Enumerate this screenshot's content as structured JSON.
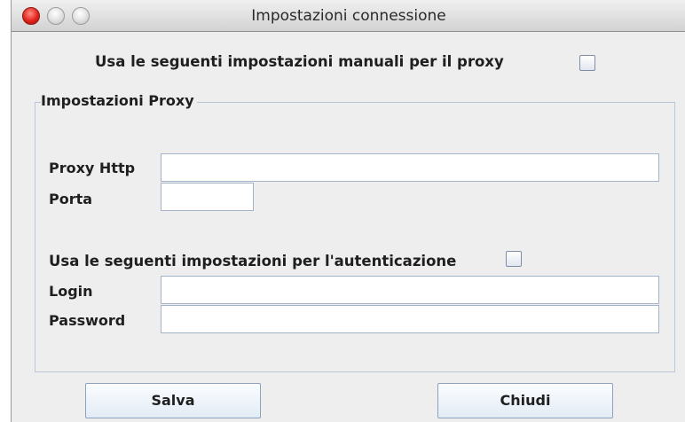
{
  "window": {
    "title": "Impostazioni connessione"
  },
  "proxy_toggle": {
    "label": "Usa le seguenti impostazioni manuali per il proxy",
    "checked": false
  },
  "proxy_group": {
    "title": "Impostazioni Proxy",
    "http_label": "Proxy Http",
    "http_value": "",
    "port_label": "Porta",
    "port_value": ""
  },
  "auth_toggle": {
    "label": "Usa le seguenti impostazioni per l'autenticazione",
    "checked": false
  },
  "auth": {
    "login_label": "Login",
    "login_value": "",
    "password_label": "Password",
    "password_value": ""
  },
  "buttons": {
    "save": "Salva",
    "close": "Chiudi"
  }
}
